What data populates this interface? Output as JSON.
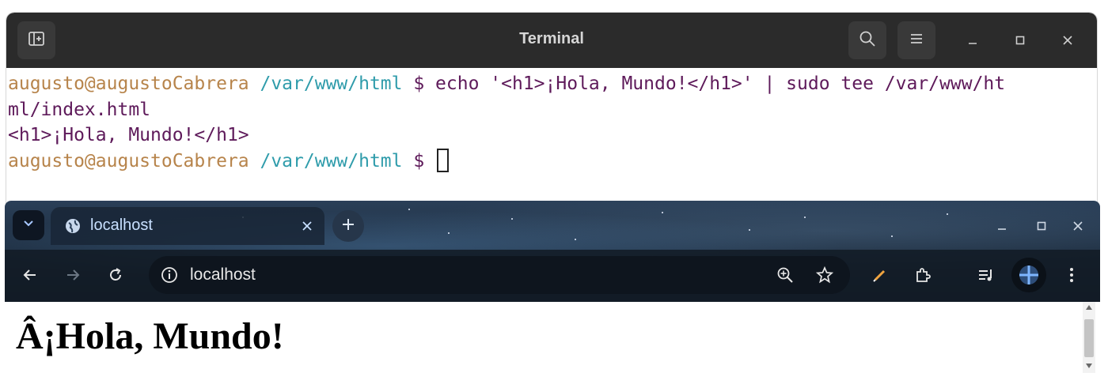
{
  "terminal": {
    "title": "Terminal",
    "lines": [
      {
        "user": "augusto@augustoCabrera",
        "path": " /var/www/html",
        "cmd": " $ echo '<h1>¡Hola, Mundo!</h1>' | sudo tee /var/www/ht"
      },
      {
        "text": "ml/index.html"
      },
      {
        "text": "<h1>¡Hola, Mundo!</h1>"
      },
      {
        "user": "augusto@augustoCabrera",
        "path": " /var/www/html",
        "cmd": " $ "
      }
    ],
    "icons": [
      "new-tab-icon",
      "search-icon",
      "menu-icon",
      "minimize-icon",
      "maximize-icon",
      "close-icon"
    ]
  },
  "browser": {
    "tab": {
      "title": "localhost"
    },
    "address": {
      "value": "localhost"
    },
    "page": {
      "heading": "Â¡Hola, Mundo!"
    },
    "icons": [
      "tab-search-icon",
      "globe-icon",
      "tab-close-icon",
      "new-tab-plus-icon",
      "back-icon",
      "forward-icon",
      "reload-icon",
      "site-info-icon",
      "zoom-icon",
      "bookmark-star-icon",
      "pen-icon",
      "extensions-icon",
      "media-icon",
      "profile-icon",
      "more-icon"
    ]
  }
}
